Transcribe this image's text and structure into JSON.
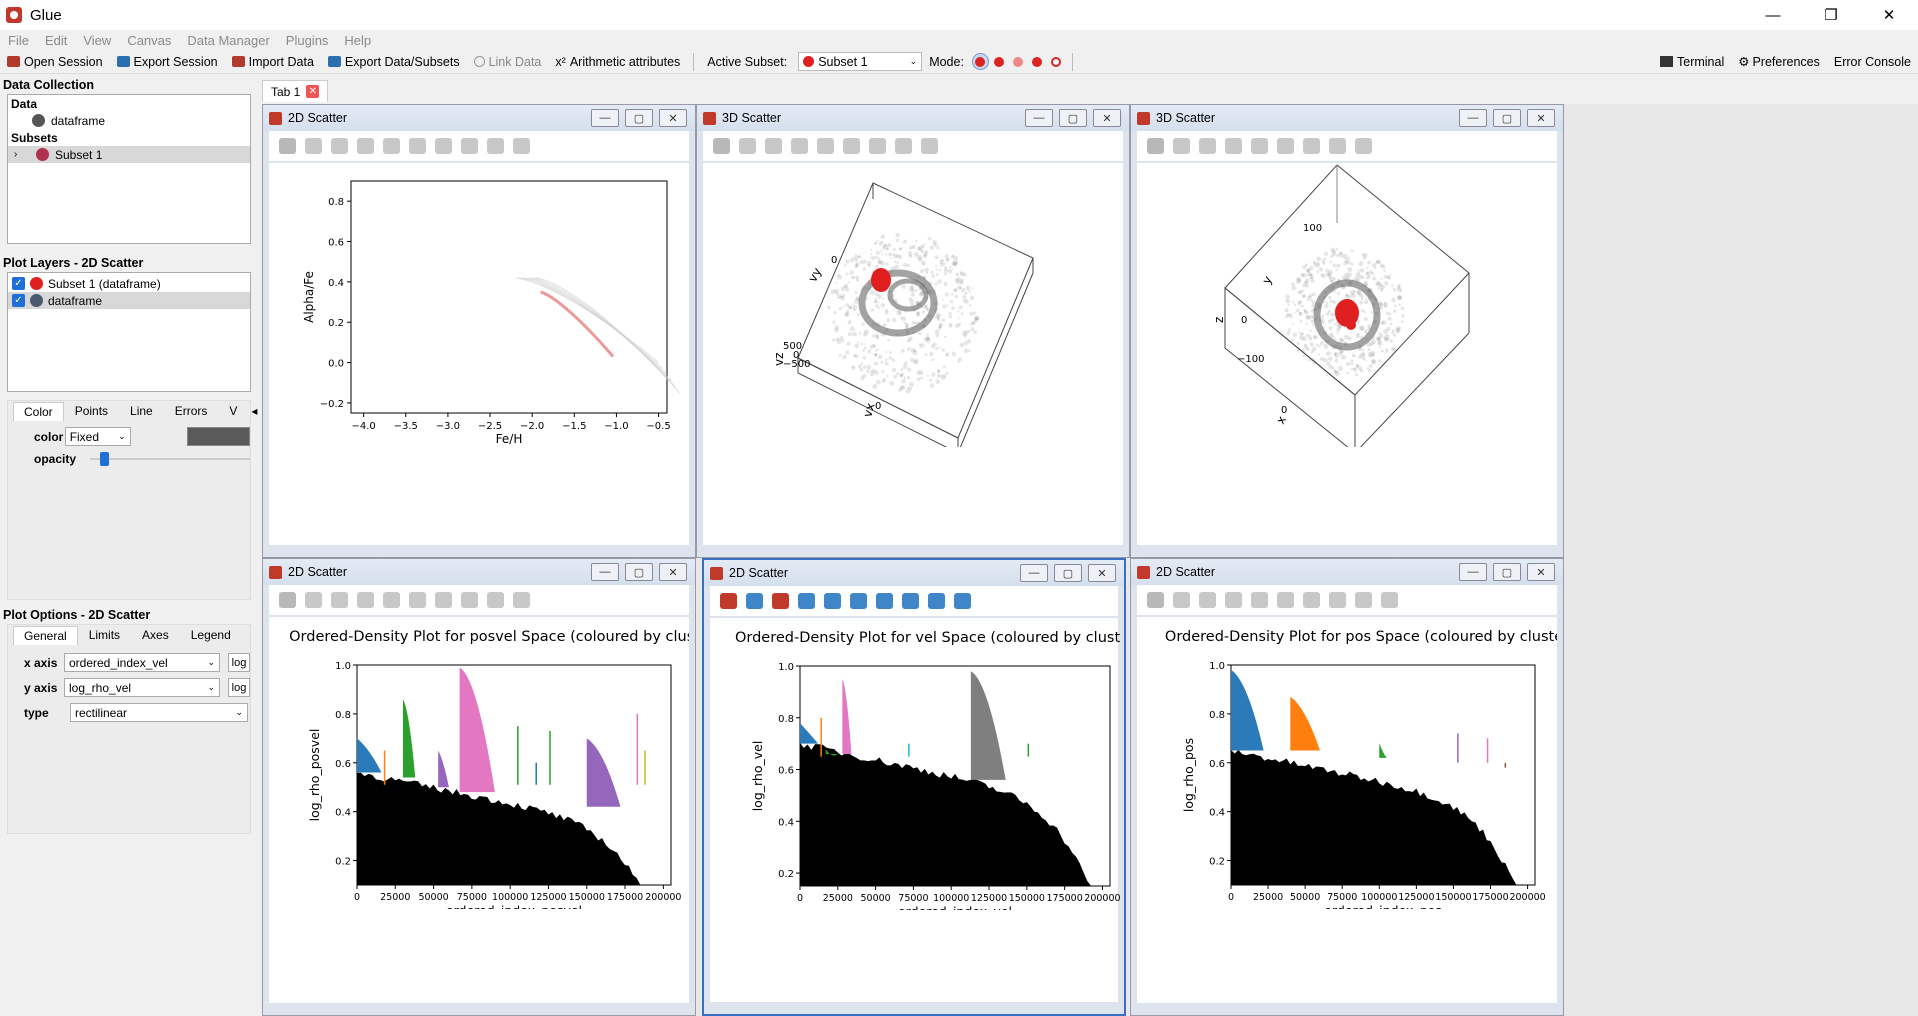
{
  "window": {
    "title": "Glue"
  },
  "menu": [
    "File",
    "Edit",
    "View",
    "Canvas",
    "Data Manager",
    "Plugins",
    "Help"
  ],
  "toolbar": {
    "open_session": "Open Session",
    "export_session": "Export Session",
    "import_data": "Import Data",
    "export_data": "Export Data/Subsets",
    "link_data": "Link Data",
    "arith": "Arithmetic attributes",
    "active_subset_label": "Active Subset:",
    "active_subset": "Subset 1",
    "mode_label": "Mode:",
    "terminal": "Terminal",
    "preferences": "Preferences",
    "error_console": "Error Console",
    "arith_icon": "x²"
  },
  "data_collection": {
    "title": "Data Collection",
    "data_header": "Data",
    "data_items": [
      "dataframe"
    ],
    "subsets_header": "Subsets",
    "subsets": [
      "Subset 1"
    ]
  },
  "plot_layers": {
    "title": "Plot Layers - 2D Scatter",
    "layers": [
      {
        "label": "Subset 1 (dataframe)",
        "color": "#e02020"
      },
      {
        "label": "dataframe",
        "color": "#4a5a70"
      }
    ]
  },
  "layer_style": {
    "tabs": [
      "Color",
      "Points",
      "Line",
      "Errors"
    ],
    "tab_more": "V",
    "color_label": "color",
    "color_mode": "Fixed",
    "opacity_label": "opacity"
  },
  "plot_options": {
    "title": "Plot Options - 2D Scatter",
    "tabs": [
      "General",
      "Limits",
      "Axes",
      "Legend"
    ],
    "x_axis_label": "x axis",
    "x_axis": "ordered_index_vel",
    "y_axis_label": "y axis",
    "y_axis": "log_rho_vel",
    "type_label": "type",
    "type": "rectilinear",
    "log": "log"
  },
  "tabs": {
    "tab1": "Tab 1"
  },
  "panels": {
    "p1": {
      "title": "2D Scatter"
    },
    "p2": {
      "title": "3D Scatter"
    },
    "p3": {
      "title": "3D Scatter"
    },
    "p4": {
      "title": "2D Scatter"
    },
    "p5": {
      "title": "2D Scatter"
    },
    "p6": {
      "title": "2D Scatter"
    }
  },
  "chart_data": [
    {
      "type": "scatter",
      "xlabel": "Fe/H",
      "ylabel": "Alpha/Fe",
      "xticks": [
        "−4.0",
        "−3.5",
        "−3.0",
        "−2.5",
        "−2.0",
        "−1.5",
        "−1.0",
        "−0.5"
      ],
      "yticks": [
        "−0.2",
        "0.0",
        "0.2",
        "0.4",
        "0.6",
        "0.8"
      ],
      "xlim": [
        -4.15,
        -0.4
      ],
      "ylim": [
        -0.25,
        0.9
      ]
    },
    {
      "type": "scatter",
      "title": "3D Scatter",
      "axis_labels": [
        "vx",
        "vy",
        "vz"
      ],
      "ticks": [
        "0",
        "0",
        "500",
        "0",
        "−500",
        "0"
      ]
    },
    {
      "type": "scatter",
      "title": "3D Scatter",
      "axis_labels": [
        "x",
        "y",
        "z"
      ],
      "ticks": [
        "100",
        "0",
        "−100",
        "0"
      ]
    },
    {
      "type": "bar",
      "title": "Ordered-Density Plot for posvel Space (coloured by cluste",
      "xlabel": "ordered_index_posvel",
      "ylabel": "log_rho_posvel",
      "xticks": [
        "0",
        "25000",
        "50000",
        "75000",
        "100000",
        "125000",
        "150000",
        "175000",
        "200000"
      ],
      "yticks": [
        "0.2",
        "0.4",
        "0.6",
        "0.8",
        "1.0"
      ],
      "ylim": [
        0.1,
        1.0
      ]
    },
    {
      "type": "bar",
      "title": "Ordered-Density Plot for vel Space (coloured by cluster",
      "xlabel": "ordered_index_vel",
      "ylabel": "log_rho_vel",
      "xticks": [
        "0",
        "25000",
        "50000",
        "75000",
        "100000",
        "125000",
        "150000",
        "175000",
        "200000"
      ],
      "yticks": [
        "0.2",
        "0.4",
        "0.6",
        "0.8",
        "1.0"
      ],
      "ylim": [
        0.15,
        1.0
      ]
    },
    {
      "type": "bar",
      "title": "Ordered-Density Plot for pos Space (coloured by cluster",
      "xlabel": "ordered_index_pos",
      "ylabel": "log_rho_pos",
      "xticks": [
        "0",
        "25000",
        "50000",
        "75000",
        "100000",
        "125000",
        "150000",
        "175000",
        "200000"
      ],
      "yticks": [
        "0.2",
        "0.4",
        "0.6",
        "0.8",
        "1.0"
      ],
      "ylim": [
        0.1,
        1.0
      ]
    }
  ]
}
